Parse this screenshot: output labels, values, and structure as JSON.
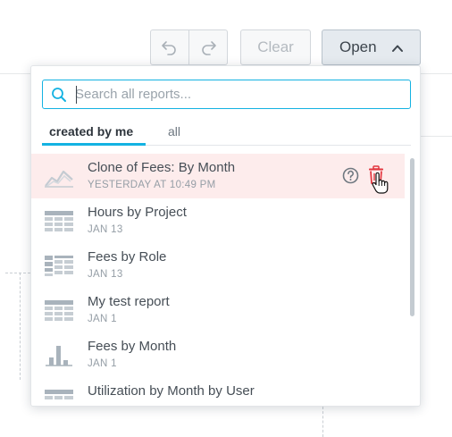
{
  "toolbar": {
    "undo_icon": "undo-arrow-icon",
    "redo_icon": "redo-arrow-icon",
    "clear_label": "Clear",
    "open_label": "Open",
    "open_icon": "chevron-up-icon"
  },
  "search": {
    "placeholder": "Search all reports...",
    "value": ""
  },
  "tabs": [
    {
      "label": "created by me",
      "active": true
    },
    {
      "label": "all",
      "active": false
    }
  ],
  "reports": [
    {
      "name": "Clone of Fees: By Month",
      "date": "YESTERDAY AT 10:49 PM",
      "icon": "line-chart-icon",
      "hovered": true
    },
    {
      "name": "Hours by Project",
      "date": "JAN 13",
      "icon": "table-icon"
    },
    {
      "name": "Fees by Role",
      "date": "JAN 13",
      "icon": "pivot-table-icon"
    },
    {
      "name": "My test report",
      "date": "JAN 1",
      "icon": "table-icon"
    },
    {
      "name": "Fees by Month",
      "date": "JAN 1",
      "icon": "bar-chart-icon"
    },
    {
      "name": "Utilization by Month by User",
      "date": "",
      "icon": "table-icon"
    }
  ],
  "colors": {
    "accent": "#14b2e2",
    "hover_row": "#fdecec",
    "delete": "#e2363f",
    "icon_gray": "#a9b3bc"
  }
}
